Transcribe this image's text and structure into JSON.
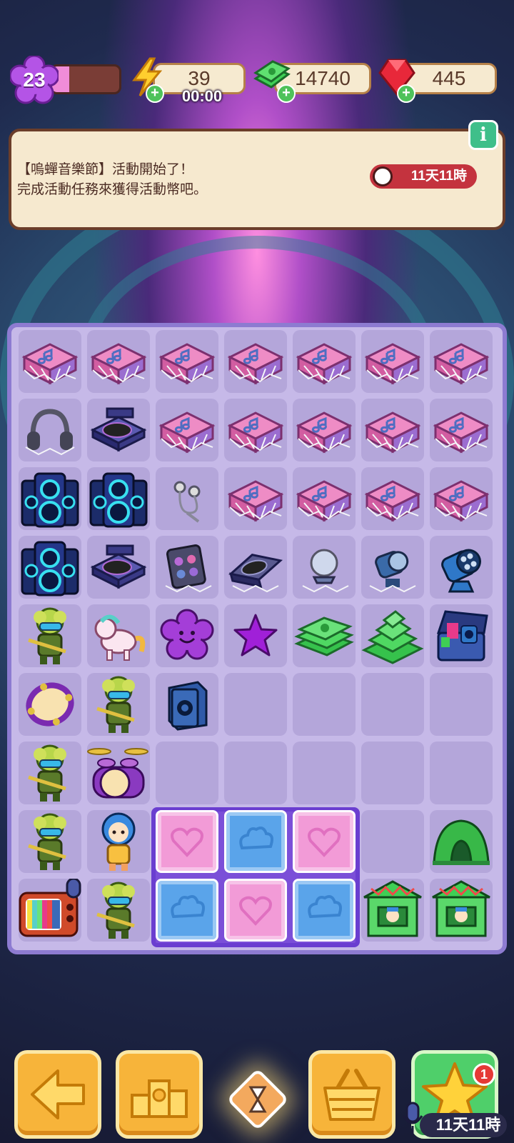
{
  "hud": {
    "level": "23",
    "xp_progress": 0.25,
    "energy": "39",
    "energy_timer": "00:00",
    "cash": "14740",
    "gems": "445"
  },
  "banner": {
    "line1": "【嗚蟬音樂節】活動開始了！",
    "line2": "完成活動任務來獲得活動幣吧。",
    "timer": "11天11時",
    "info_label": "i"
  },
  "board": {
    "rows": [
      [
        "music-box-webbed",
        "music-box-webbed",
        "music-box-webbed",
        "music-box-webbed",
        "music-box-webbed",
        "music-box-webbed",
        "music-box-webbed"
      ],
      [
        "headphones-webbed",
        "dj-turntable",
        "music-box-webbed",
        "music-box-webbed",
        "music-box-webbed",
        "music-box-webbed",
        "music-box-webbed"
      ],
      [
        "speaker-tower",
        "speaker-tower",
        "earphones-webbed",
        "music-box-webbed",
        "music-box-webbed",
        "music-box-webbed",
        "music-box-webbed"
      ],
      [
        "speaker-tower",
        "dj-turntable",
        "eyeshadow-palette-webbed",
        "dj-turntable-webbed",
        "crystal-ball-webbed",
        "spotlight-webbed",
        "spotlight"
      ],
      [
        "rocker-guitarist",
        "pony-toy",
        "purple-smiley-blob",
        "purple-star",
        "cash-stack",
        "cash-pile",
        "music-chest"
      ],
      [
        "tambourine",
        "rocker-guitarist",
        "small-speaker",
        "empty",
        "empty",
        "empty",
        "empty"
      ],
      [
        "rocker-guitarist",
        "drum-kit",
        "empty",
        "empty",
        "empty",
        "empty",
        "empty"
      ],
      [
        "rocker-guitarist",
        "singer-girl",
        "crate",
        "crate",
        "crate",
        "empty",
        "green-tent"
      ],
      [
        "retro-tv",
        "rocker-guitarist",
        "crate",
        "crate",
        "crate",
        "house-stall",
        "house-stall"
      ]
    ],
    "crates": [
      "pink",
      "blue",
      "pink",
      "blue",
      "pink",
      "blue"
    ]
  },
  "bottom": {
    "notification_count": "1",
    "event_timer": "11天11時"
  },
  "colors": {
    "resource_box_bg": "#f6ead0",
    "board_bg": "#c6b9e8",
    "button_orange": "#f7b43a",
    "button_green": "#4fcf6a",
    "timer_red": "#c4333e"
  }
}
